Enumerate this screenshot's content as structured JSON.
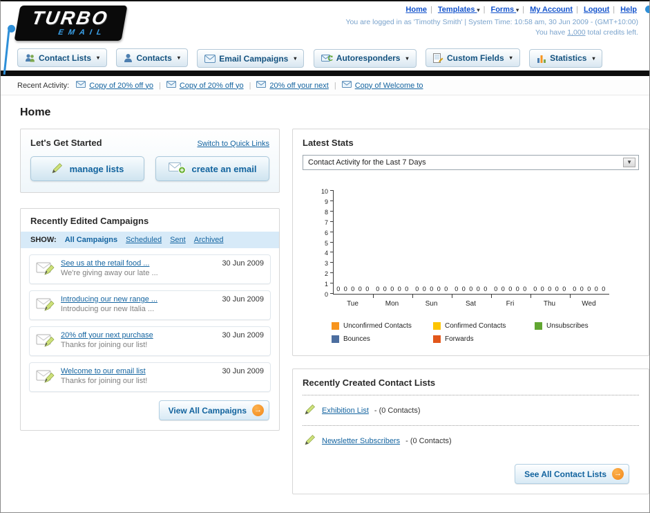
{
  "header": {
    "logo_title": "TURBO",
    "logo_subtitle": "EMAIL",
    "nav_links": {
      "home": "Home",
      "templates": "Templates",
      "forms": "Forms",
      "my_account": "My Account",
      "logout": "Logout",
      "help": "Help"
    },
    "login_info": "You are logged in as 'Timothy Smith' | System Time: 10:58 am, 30 Jun 2009 - (GMT+10:00)",
    "credits_prefix": "You have",
    "credits_value": "1,000",
    "credits_suffix": "total credits left."
  },
  "nav": {
    "tabs": [
      {
        "label": "Contact Lists"
      },
      {
        "label": "Contacts"
      },
      {
        "label": "Email Campaigns"
      },
      {
        "label": "Autoresponders"
      },
      {
        "label": "Custom Fields"
      },
      {
        "label": "Statistics"
      }
    ]
  },
  "recent_activity": {
    "label": "Recent Activity:",
    "items": [
      {
        "text": "Copy of 20% off yo"
      },
      {
        "text": "Copy of 20% off yo"
      },
      {
        "text": "20% off your next"
      },
      {
        "text": "Copy of Welcome to"
      }
    ]
  },
  "page_title": "Home",
  "get_started": {
    "title": "Let's Get Started",
    "switch_link": "Switch to Quick Links",
    "manage_lists_button": "manage lists",
    "create_email_button": "create an email"
  },
  "campaigns": {
    "title": "Recently Edited Campaigns",
    "show_label": "SHOW:",
    "filters": [
      {
        "label": "All Campaigns"
      },
      {
        "label": "Scheduled"
      },
      {
        "label": "Sent"
      },
      {
        "label": "Archived"
      }
    ],
    "items": [
      {
        "title": "See us at the retail food ...",
        "subtitle": "We're giving away our late ...",
        "date": "30 Jun 2009"
      },
      {
        "title": "Introducing our new range ...",
        "subtitle": "Introducing our new Italia ...",
        "date": "30 Jun 2009"
      },
      {
        "title": "20% off your next purchase",
        "subtitle": "Thanks for joining our list!",
        "date": "30 Jun 2009"
      },
      {
        "title": "Welcome to our email list",
        "subtitle": "Thanks for joining our list!",
        "date": "30 Jun 2009"
      }
    ],
    "view_all_button": "View All Campaigns"
  },
  "stats": {
    "title": "Latest Stats",
    "dropdown_value": "Contact Activity for the Last 7 Days",
    "chart_data": {
      "type": "bar",
      "title": "Contact Activity for the Last 7 Days",
      "categories": [
        "Tue",
        "Mon",
        "Sun",
        "Sat",
        "Fri",
        "Thu",
        "Wed"
      ],
      "series": [
        {
          "name": "Unconfirmed Contacts",
          "color": "#f7941d",
          "values": [
            0,
            0,
            0,
            0,
            0,
            0,
            0
          ]
        },
        {
          "name": "Confirmed Contacts",
          "color": "#fdc500",
          "values": [
            0,
            0,
            0,
            0,
            0,
            0,
            0
          ]
        },
        {
          "name": "Unsubscribes",
          "color": "#61a631",
          "values": [
            0,
            0,
            0,
            0,
            0,
            0,
            0
          ]
        },
        {
          "name": "Bounces",
          "color": "#4c6e9f",
          "values": [
            0,
            0,
            0,
            0,
            0,
            0,
            0
          ]
        },
        {
          "name": "Forwards",
          "color": "#e2571b",
          "values": [
            0,
            0,
            0,
            0,
            0,
            0,
            0
          ]
        }
      ],
      "xlabel": "",
      "ylabel": "",
      "ylim": [
        0,
        10
      ],
      "ytick_step": 1,
      "grid": false,
      "legend_position": "bottom"
    }
  },
  "contact_lists": {
    "title": "Recently Created Contact Lists",
    "items": [
      {
        "name": "Exhibition List",
        "detail": "- (0 Contacts)"
      },
      {
        "name": "Newsletter Subscribers",
        "detail": "- (0 Contacts)"
      }
    ],
    "see_all_button": "See All Contact Lists"
  }
}
